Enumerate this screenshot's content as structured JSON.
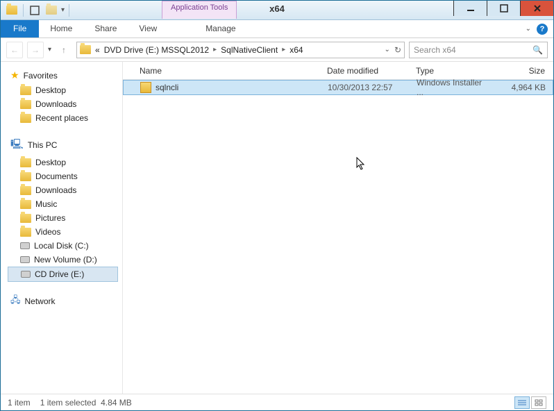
{
  "title": "x64",
  "tools_tab": "Application Tools",
  "ribbon": {
    "file": "File",
    "home": "Home",
    "share": "Share",
    "view": "View",
    "manage": "Manage"
  },
  "breadcrumb": {
    "prefix": "«",
    "parts": [
      "DVD Drive (E:) MSSQL2012",
      "SqlNativeClient",
      "x64"
    ]
  },
  "search": {
    "placeholder": "Search x64"
  },
  "nav": {
    "favorites": {
      "label": "Favorites",
      "items": [
        "Desktop",
        "Downloads",
        "Recent places"
      ]
    },
    "this_pc": {
      "label": "This PC",
      "items": [
        "Desktop",
        "Documents",
        "Downloads",
        "Music",
        "Pictures",
        "Videos",
        "Local Disk (C:)",
        "New Volume (D:)",
        "CD Drive (E:)"
      ]
    },
    "network": {
      "label": "Network"
    }
  },
  "columns": {
    "name": "Name",
    "date": "Date modified",
    "type": "Type",
    "size": "Size"
  },
  "files": [
    {
      "name": "sqlncli",
      "date": "10/30/2013 22:57",
      "type": "Windows Installer ...",
      "size": "4,964 KB"
    }
  ],
  "status": {
    "count": "1 item",
    "selected": "1 item selected",
    "size": "4.84 MB"
  }
}
